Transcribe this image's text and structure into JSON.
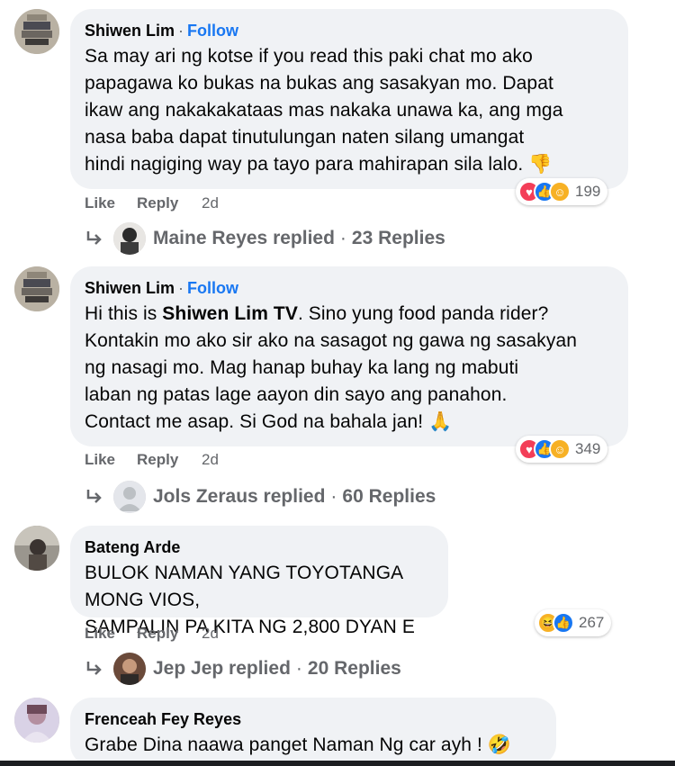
{
  "comments": [
    {
      "author": "Shiwen Lim",
      "follow_label": "Follow",
      "text_before_bold": "Sa may ari ng kotse if you read this paki chat mo ako\npapagawa ko bukas na bukas ang sasakyan mo. Dapat\nikaw ang nakakakataas mas nakaka unawa ka, ang mga\nnasa baba dapat tinutulungan naten silang umangat\nhindi nagiging way pa tayo para mahirapan sila lalo.",
      "trailing_emoji": "👎",
      "reaction_count": "199",
      "like_label": "Like",
      "reply_label": "Reply",
      "time": "2d",
      "replied_by": "Maine Reyes replied",
      "replies_count": "23 Replies"
    },
    {
      "author": "Shiwen Lim",
      "follow_label": "Follow",
      "text_prefix": "Hi this is ",
      "text_bold": "Shiwen Lim TV",
      "text_suffix": ". Sino yung food panda rider?\nKontakin mo ako sir ako na sasagot ng gawa ng sasakyan\nng nasagi mo. Mag hanap buhay ka lang ng mabuti\nlaban ng patas lage aayon din sayo ang panahon.\nContact me asap. Si God na bahala jan!",
      "trailing_emoji": "🙏",
      "reaction_count": "349",
      "like_label": "Like",
      "reply_label": "Reply",
      "time": "2d",
      "replied_by": "Jols Zeraus replied",
      "replies_count": "60 Replies"
    },
    {
      "author": "Bateng Arde",
      "text": "BULOK NAMAN YANG TOYOTANGA MONG VIOS,\nSAMPALIN PA KITA NG 2,800 DYAN E",
      "reaction_count": "267",
      "like_label": "Like",
      "reply_label": "Reply",
      "time": "2d",
      "replied_by": "Jep Jep replied",
      "replies_count": "20 Replies"
    },
    {
      "author": "Frenceah Fey Reyes",
      "text": "Grabe Dina naawa panget Naman Ng car ayh !",
      "trailing_emoji": "🤣"
    }
  ],
  "colors": {
    "link": "#1877f2",
    "bubble": "#f0f2f5",
    "meta": "#65676b"
  },
  "icons": [
    "reply-arrow-icon",
    "love-reaction-icon",
    "like-reaction-icon",
    "care-reaction-icon",
    "haha-reaction-icon"
  ]
}
